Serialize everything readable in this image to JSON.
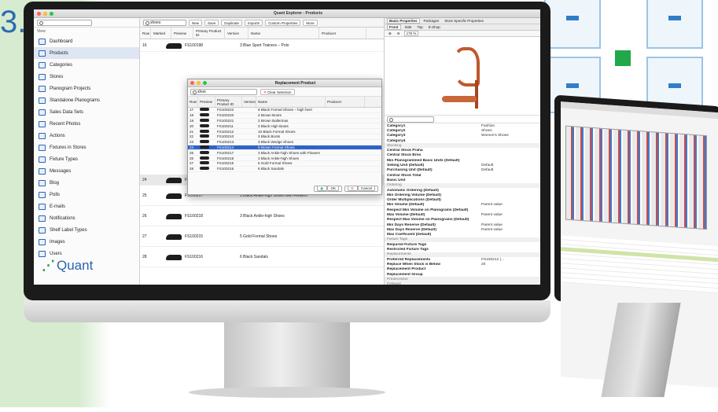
{
  "step_label": "3.",
  "window": {
    "title": "Quant Explorer - Products"
  },
  "sidebar": {
    "view_label": "View",
    "items": [
      {
        "label": "Dashboard",
        "icon": "dashboard-icon"
      },
      {
        "label": "Products",
        "icon": "products-icon"
      },
      {
        "label": "Categories",
        "icon": "categories-icon"
      },
      {
        "label": "Stores",
        "icon": "stores-icon"
      },
      {
        "label": "Planogram Projects",
        "icon": "planogram-projects-icon"
      },
      {
        "label": "Standalone Planograms",
        "icon": "planogram-icon"
      },
      {
        "label": "Sales Data Sets",
        "icon": "sales-data-icon"
      },
      {
        "label": "Recent Photos",
        "icon": "photos-icon"
      },
      {
        "label": "Actions",
        "icon": "actions-icon"
      },
      {
        "label": "Fixtures in Stores",
        "icon": "fixtures-icon"
      },
      {
        "label": "Fixture Types",
        "icon": "fixture-types-icon"
      },
      {
        "label": "Messages",
        "icon": "messages-icon"
      },
      {
        "label": "Blog",
        "icon": "blog-icon"
      },
      {
        "label": "Polls",
        "icon": "polls-icon"
      },
      {
        "label": "E-mails",
        "icon": "email-icon"
      },
      {
        "label": "Notifications",
        "icon": "notifications-icon"
      },
      {
        "label": "Shelf Label Types",
        "icon": "shelf-label-icon"
      },
      {
        "label": "Images",
        "icon": "images-icon"
      },
      {
        "label": "Users",
        "icon": "users-icon"
      }
    ],
    "logo_text": "Quant"
  },
  "toolbar": {
    "search_value": "shoes",
    "new_label": "New",
    "save_label": "Save",
    "duplicate_label": "Duplicate",
    "imports_label": "Imports",
    "custom_props_label": "Custom Properties",
    "more_label": "More"
  },
  "table": {
    "headers": [
      "Row",
      "Marked",
      "Preview",
      "Primary Product ID",
      "Version",
      "Name",
      "Producer"
    ],
    "top_row": {
      "row": "16",
      "id": "FS100198",
      "name": "3 Blue Sport Trainers – Polo"
    },
    "rows": [
      {
        "row": "24",
        "id": "FS100214",
        "name": "9 Brown Formal Shoes"
      },
      {
        "row": "25",
        "id": "FS100217",
        "name": "3 Black Ankle-high Shoes with Flowers"
      },
      {
        "row": "26",
        "id": "FS100218",
        "name": "3 Black Ankle-high Shoes"
      },
      {
        "row": "27",
        "id": "FS100215",
        "name": "5 Gold Formal Shoes"
      },
      {
        "row": "28",
        "id": "FS100216",
        "name": "6 Black Sandals"
      }
    ]
  },
  "dialog": {
    "title": "Replacement Product",
    "search_value": "shoe",
    "clear_label": "Clear Selection",
    "headers": [
      "Row",
      "Preview",
      "Primary Product ID",
      "Version",
      "Name",
      "Producer"
    ],
    "rows": [
      {
        "row": "17",
        "id": "FS100222",
        "name": "8 Black Formal Shoes – high heel"
      },
      {
        "row": "18",
        "id": "FS100220",
        "name": "2 Brown Boots"
      },
      {
        "row": "19",
        "id": "FS100221",
        "name": "2 Brown Ballerinas"
      },
      {
        "row": "20",
        "id": "FS100211",
        "name": "3 Black High Boots"
      },
      {
        "row": "21",
        "id": "FS100212",
        "name": "10 Black Formal Shoes"
      },
      {
        "row": "22",
        "id": "FS100210",
        "name": "3 Black Boots"
      },
      {
        "row": "23",
        "id": "FS100213",
        "name": "3 Black Wedge Shoes"
      },
      {
        "row": "24",
        "id": "FS100214",
        "name": "9 Brown Formal Shoes"
      },
      {
        "row": "25",
        "id": "FS100217",
        "name": "3 Black Ankle-high Shoes with Flowers"
      },
      {
        "row": "26",
        "id": "FS100218",
        "name": "3 Black Ankle-high Shoes"
      },
      {
        "row": "27",
        "id": "FS100215",
        "name": "5 Gold Formal Shoes"
      },
      {
        "row": "28",
        "id": "FS100216",
        "name": "6 Black Sandals"
      }
    ],
    "selected_index": 7,
    "ok_label": "OK",
    "cancel_label": "Cancel"
  },
  "props": {
    "tabs": [
      "Basic Properties",
      "Packages",
      "Store Specific Properties"
    ],
    "subtabs": [
      "Front",
      "Side",
      "Top",
      "E-Shop"
    ],
    "zoom": "176 %",
    "rows": [
      {
        "k": "Category1",
        "v": "Fashion",
        "grp": false
      },
      {
        "k": "Category2",
        "v": "Shoes",
        "grp": false
      },
      {
        "k": "Category3",
        "v": "Women's Shoes",
        "grp": false
      },
      {
        "k": "Category4",
        "v": "",
        "grp": false
      },
      {
        "k": "Stocking",
        "v": "",
        "grp": true
      },
      {
        "k": "Central Stock Praha",
        "v": "",
        "grp": false
      },
      {
        "k": "Central Stock Brno",
        "v": "",
        "grp": false
      },
      {
        "k": "Min Planogrammed Basic Units (Default)",
        "v": "",
        "grp": false
      },
      {
        "k": "Selling Unit (Default)",
        "v": "Default",
        "grp": false
      },
      {
        "k": "Purchasing Unit (Default)",
        "v": "Default",
        "grp": false
      },
      {
        "k": "Central Stock Total",
        "v": "",
        "grp": false
      },
      {
        "k": "Basic Unit",
        "v": "",
        "grp": false
      },
      {
        "k": "Ordering",
        "v": "",
        "grp": true
      },
      {
        "k": "Automatic Ordering (Default)",
        "v": "",
        "grp": false
      },
      {
        "k": "Min Ordering Volume (Default)",
        "v": "",
        "grp": false
      },
      {
        "k": "Order Multiplications (Default)",
        "v": "",
        "grp": false
      },
      {
        "k": "Min Volume (Default)",
        "v": "Parent value",
        "grp": false
      },
      {
        "k": "Respect Min Volume on Planograms (Default)",
        "v": "",
        "grp": false
      },
      {
        "k": "Max Volume (Default)",
        "v": "Parent value",
        "grp": false
      },
      {
        "k": "Respect Max Volume on Planograms (Default)",
        "v": "",
        "grp": false
      },
      {
        "k": "Min Days Reserve (Default)",
        "v": "Parent value",
        "grp": false
      },
      {
        "k": "Max Days Reserve (Default)",
        "v": "Parent value",
        "grp": false
      },
      {
        "k": "Max Coefficient (Default)",
        "v": "",
        "grp": false
      },
      {
        "k": "Fixture Tags",
        "v": "",
        "grp": true
      },
      {
        "k": "Required Fixture Tags",
        "v": "",
        "grp": false
      },
      {
        "k": "Restricted Fixture Tags",
        "v": "",
        "grp": false
      },
      {
        "k": "Replacements",
        "v": "",
        "grp": true
      },
      {
        "k": "Preferred Replacements",
        "v": "FS100212 (...",
        "grp": false
      },
      {
        "k": "Replace When Stock is Below",
        "v": "20",
        "grp": false
      },
      {
        "k": "Replacement Product",
        "v": "",
        "grp": false
      },
      {
        "k": "Replacement Group",
        "v": "",
        "grp": false
      },
      {
        "k": "Predecessor",
        "v": "",
        "grp": true
      },
      {
        "k": "Follower",
        "v": "",
        "grp": true
      },
      {
        "k": "SELs pictograms",
        "v": "",
        "grp": true
      }
    ]
  }
}
